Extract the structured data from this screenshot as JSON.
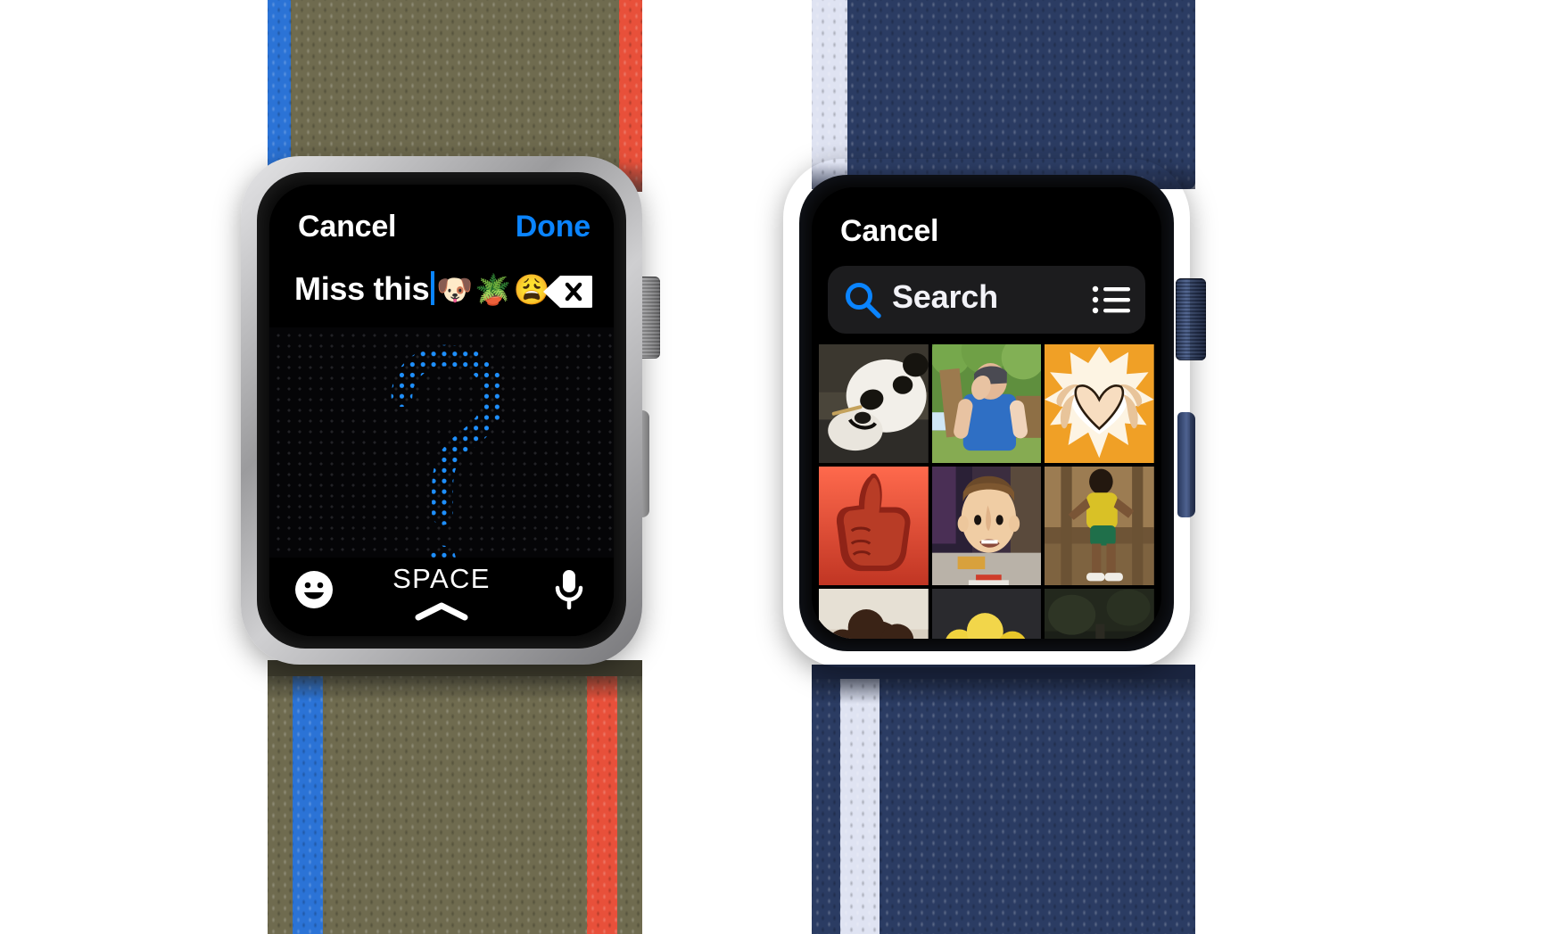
{
  "scene": {
    "background": "#ffffff",
    "device_count": 2,
    "devices": [
      "apple-watch-scribble-keyboard",
      "apple-watch-gif-picker"
    ]
  },
  "watch_left": {
    "case_color": "#b9b9bb",
    "band": {
      "main_color": "#6f6b4f",
      "left_stripe_color": "#1f6fd0",
      "right_stripe_color": "#e8503a",
      "name": "sport-loop-olive"
    },
    "screen": {
      "nav": {
        "cancel_label": "Cancel",
        "done_label": "Done",
        "done_color": "#0a84ff"
      },
      "input": {
        "text": "Miss this",
        "emoji": "🐶🪴😩",
        "caret_color": "#0a84ff",
        "delete_key_icon": "delete-backward-icon"
      },
      "canvas": {
        "mode": "scribble",
        "drawn_character": "?",
        "stroke_color": "#1a8cff",
        "dot_grid": true
      },
      "keyrow": {
        "emoji_key_icon": "smiley-face-icon",
        "space_label": "SPACE",
        "chevron_icon": "chevron-up-icon",
        "mic_icon": "microphone-icon"
      }
    }
  },
  "watch_right": {
    "case_color": "#2b3a5c",
    "band": {
      "main_color": "#2b3c63",
      "left_stripe_color": "#dfe3f2",
      "name": "sport-loop-navy"
    },
    "screen": {
      "nav": {
        "cancel_label": "Cancel"
      },
      "search": {
        "placeholder": "Search",
        "magnifier_icon": "search-icon",
        "magnifier_color": "#0a84ff",
        "list_icon": "list-bullet-icon",
        "field_bg": "#1c1c1e"
      },
      "grid": {
        "columns": 3,
        "tiles": [
          {
            "name": "tile-panda",
            "alt": "panda eating bamboo"
          },
          {
            "name": "tile-facepalm",
            "alt": "man facepalming outdoors"
          },
          {
            "name": "tile-heart-hands",
            "alt": "comic hands making heart"
          },
          {
            "name": "tile-thumbs-up",
            "alt": "red thumbs up"
          },
          {
            "name": "tile-cartoon-boy",
            "alt": "cartoon boy shrugging"
          },
          {
            "name": "tile-dancer",
            "alt": "person dancing in yellow shirt"
          },
          {
            "name": "tile-curly-hair",
            "alt": "person with curly hair"
          },
          {
            "name": "tile-yellow-toy",
            "alt": "yellow character"
          },
          {
            "name": "tile-dark-scene",
            "alt": "dark outdoor scene"
          }
        ]
      }
    }
  }
}
